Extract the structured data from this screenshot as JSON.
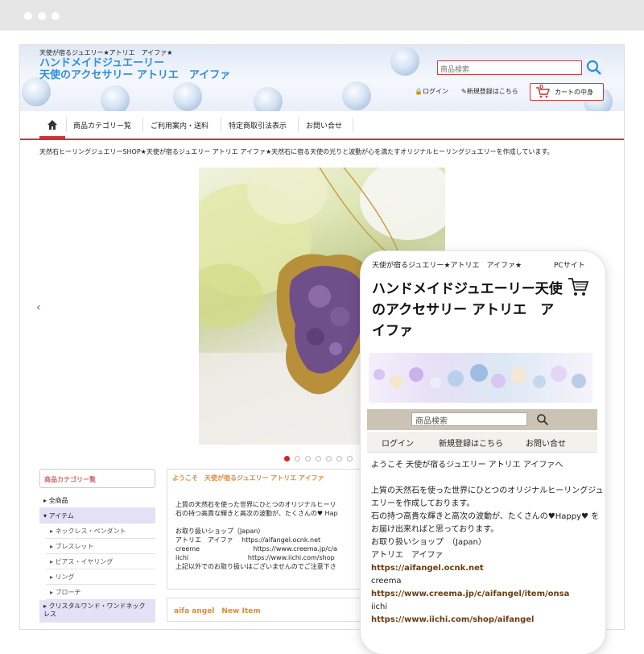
{
  "header": {
    "tagline": "天使が宿るジュエリー★アトリエ　アイファ★",
    "title_line1": "ハンドメイドジュエーリー",
    "title_line2": "天使のアクセサリー アトリエ　アイファ",
    "search_placeholder": "商品検索",
    "login": "ログイン",
    "register": "新規登録はこちら",
    "cart_label": "カートの中身",
    "cart_count": "0"
  },
  "nav": {
    "items": [
      "商品カテゴリー覧",
      "ご利用案内・送料",
      "特定商取引法表示",
      "お問い合せ"
    ]
  },
  "intro_text": "天然石ヒーリングジュエリーSHOP★天使が宿るジュエリー アトリエ アイファ★天然石に宿る天使の光りと波動が心を満たすオリジナルヒーリングジュエリーを作成しています。",
  "slider": {
    "dots": 7,
    "active": 0,
    "prev": "‹",
    "next": "›"
  },
  "sidebar": {
    "heading": "商品カテゴリー覧",
    "items": [
      {
        "label": "全商品",
        "type": "normal"
      },
      {
        "label": "アイテム",
        "type": "active"
      },
      {
        "label": "ネックレス・ペンダント",
        "type": "sub"
      },
      {
        "label": "ブレスレット",
        "type": "sub"
      },
      {
        "label": "ピアス・イヤリング",
        "type": "sub"
      },
      {
        "label": "リング",
        "type": "sub"
      },
      {
        "label": "ブローチ",
        "type": "sub"
      },
      {
        "label": "クリスタルワンド・ワンドネックレス",
        "type": "big"
      }
    ]
  },
  "welcome": {
    "title": "ようこそ　天使が宿るジュエリー アトリエ アイファ",
    "text": "上質の天然石を使った世界にひとつのオリジナルヒーリ\n石の持つ高貴な輝きと高次の波動が、たくさんの♥ Hap\n\nお取り扱いショップ（Japan）\nアトリエ　アイファ　 https://aifangel.ocnk.net\ncreeme                          https://www.creema.jp/c/a\niichi                             https://www.iichi.com/shop\n上記以外でのお取り扱いはございませんのでご注意下さ"
  },
  "new_item": {
    "title": "aifa angel　New Item"
  },
  "mobile": {
    "top_text": "天使が宿るジュエリー★アトリエ　アイファ★",
    "pc_link": "PCサイト",
    "title": "ハンドメイドジュエーリー天使のアクセサリー アトリエ　アイファ",
    "search_placeholder": "商品検索",
    "menu": [
      "ログイン",
      "新規登録はこちら",
      "お問い合せ"
    ],
    "welcome": "ようこそ 天使が宿るジュエリー アトリエ アイファへ",
    "paragraph": "上質の天然石を使った世界にひとつのオリジナルヒーリングジュエリーを作成しております。",
    "paragraph2": "石の持つ高貴な輝きと高次の波動が、たくさんの♥Happy♥ をお届け出来ればと思っております。",
    "shops_heading": "お取り扱いショップ　（Japan）",
    "shop1_name": "アトリエ　アイファ",
    "shop1_url": "https://aifangel.ocnk.net",
    "shop2_name": "creema",
    "shop2_url": "https://www.creema.jp/c/aifangel/item/onsa",
    "shop3_name": "iichi",
    "shop3_url": "https://www.iichi.com/shop/aifangel"
  },
  "colors": {
    "accent_red": "#cc3333",
    "title_blue": "#2f8fd5",
    "orange_heading": "#e08a3c",
    "sidebar_highlight": "#e4e0f5"
  }
}
